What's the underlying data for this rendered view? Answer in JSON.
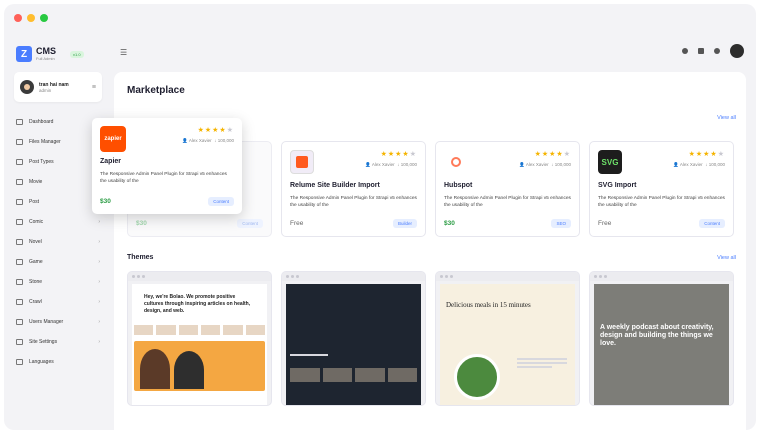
{
  "app": {
    "logo_text": "CMS",
    "logo_sub": "Full Admin",
    "logo_badge": "v1.0"
  },
  "user": {
    "name": "tran hai nam",
    "role": "admin"
  },
  "sidebar": {
    "items": [
      {
        "label": "Dashboard",
        "has_arrow": false
      },
      {
        "label": "Files Manager",
        "has_arrow": false
      },
      {
        "label": "Post Types",
        "has_arrow": true
      },
      {
        "label": "Movie",
        "has_arrow": true
      },
      {
        "label": "Post",
        "has_arrow": true
      },
      {
        "label": "Comic",
        "has_arrow": true
      },
      {
        "label": "Novel",
        "has_arrow": true
      },
      {
        "label": "Game",
        "has_arrow": true
      },
      {
        "label": "Stone",
        "has_arrow": true
      },
      {
        "label": "Crawl",
        "has_arrow": true
      },
      {
        "label": "Users Manager",
        "has_arrow": true
      },
      {
        "label": "Site Settings",
        "has_arrow": true
      },
      {
        "label": "Languages",
        "has_arrow": false
      }
    ]
  },
  "main": {
    "title": "Marketplace",
    "plugins_section": {
      "view_all": "View all"
    },
    "themes_section": {
      "title": "Themes",
      "view_all": "View all"
    }
  },
  "plugins": {
    "popup": {
      "name": "Zapier",
      "logo_text": "zapier",
      "logo_color": "#ff4f00",
      "rating": 4,
      "author": "Alex Xavier",
      "downloads": "100,000",
      "desc": "The Responsive Admin Panel Plugin for Strapi v5 enhances the usability of the",
      "price": "$30",
      "tag": "Content"
    },
    "ghost": {
      "price": "$30",
      "tag": "Content"
    },
    "cards": [
      {
        "name": "Relume Site Builder Import",
        "logo_color": "#1a1a1a",
        "rating": 4,
        "author": "Alex Xavier",
        "downloads": "100,000",
        "desc": "The Responsive Admin Panel Plugin for Strapi v5 enhances the usability of the",
        "price": "Free",
        "tag": "Builder"
      },
      {
        "name": "Hubspot",
        "logo_color": "#ff7a59",
        "rating": 4,
        "author": "Alex Xavier",
        "downloads": "100,000",
        "desc": "The Responsive Admin Panel Plugin for Strapi v5 enhances the usability of the",
        "price": "$30",
        "tag": "SEO"
      },
      {
        "name": "SVG Import",
        "logo_text": "SVG",
        "logo_color": "#1d1d1d",
        "rating": 4,
        "author": "Alex Xavier",
        "downloads": "100,000",
        "desc": "The Responsive Admin Panel Plugin for Strapi v5 enhances the usability of the",
        "price": "Free",
        "tag": "Content"
      }
    ]
  },
  "themes": [
    {
      "headline": "Hey, we're Bolao. We promote positive cultures through inspiring articles on health, design, and web."
    },
    {
      "headline": ""
    },
    {
      "headline": "Delicious meals in 15 minutes"
    },
    {
      "headline": "A weekly podcast about creativity, design and building the things we love."
    }
  ]
}
